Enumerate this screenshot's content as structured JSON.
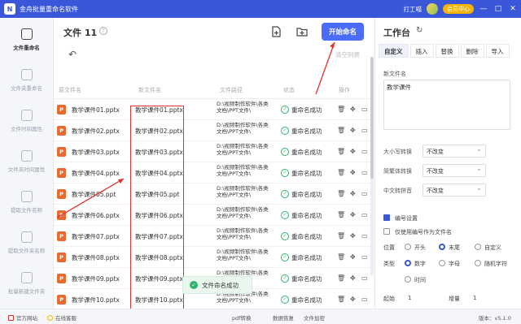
{
  "titlebar": {
    "logo": "N",
    "title": "金舟批量重命名软件",
    "user": "打工喵",
    "vip": "会员中心",
    "min": "—",
    "max": "□",
    "close": "✕"
  },
  "sidebar": {
    "items": [
      {
        "label": "文件重命名"
      },
      {
        "label": "文件夹重命名"
      },
      {
        "label": "文件时间属性"
      },
      {
        "label": "文件夹时间属性"
      },
      {
        "label": "提取文件名称"
      },
      {
        "label": "提取文件夹名称"
      },
      {
        "label": "批量新建文件夹"
      }
    ]
  },
  "main": {
    "title": "文件 11",
    "help": "?",
    "start_label": "开始命名",
    "clear_label": "清空列表",
    "back": "↶",
    "headers": {
      "orig": "原文件名",
      "new": "新文件名",
      "path": "文件路径",
      "status": "状态",
      "ops": "操作"
    },
    "rows": [
      {
        "orig": "教学课件01.pptx",
        "new": "教学课件01.pptx",
        "path": "D:\\视频制作软件\\各类文档\\PPT文件\\",
        "status": "重命名成功",
        "icon": "P"
      },
      {
        "orig": "教学课件02.pptx",
        "new": "教学课件02.pptx",
        "path": "D:\\视频制作软件\\各类文档\\PPT文件\\",
        "status": "重命名成功",
        "icon": "P"
      },
      {
        "orig": "教学课件03.pptx",
        "new": "教学课件03.pptx",
        "path": "D:\\视频制作软件\\各类文档\\PPT文件\\",
        "status": "重命名成功",
        "icon": "P"
      },
      {
        "orig": "教学课件04.pptx",
        "new": "教学课件04.pptx",
        "path": "D:\\视频制作软件\\各类文档\\PPT文件\\",
        "status": "重命名成功",
        "icon": "P"
      },
      {
        "orig": "教学课件05.ppt",
        "new": "教学课件05.ppt",
        "path": "D:\\视频制作软件\\各类文档\\PPT文件\\",
        "status": "重命名成功",
        "icon": "P"
      },
      {
        "orig": "教学课件06.pptx",
        "new": "教学课件06.pptx",
        "path": "D:\\视频制作软件\\各类文档\\PPT文件\\",
        "status": "重命名成功",
        "icon": "P"
      },
      {
        "orig": "教学课件07.pptx",
        "new": "教学课件07.pptx",
        "path": "D:\\视频制作软件\\各类文档\\PPT文件\\",
        "status": "重命名成功",
        "icon": "P"
      },
      {
        "orig": "教学课件08.pptx",
        "new": "教学课件08.pptx",
        "path": "D:\\视频制作软件\\各类文档\\PPT文件\\",
        "status": "重命名成功",
        "icon": "P"
      },
      {
        "orig": "教学课件09.pptx",
        "new": "教学课件09.pptx",
        "path": "D:\\视频制作软件\\各类文档\\PPT文件\\",
        "status": "重命名成功",
        "icon": "P"
      },
      {
        "orig": "教学课件10.pptx",
        "new": "教学课件10.pptx",
        "path": "D:\\视频制作软件\\各类文档\\PPT文件\\",
        "status": "重命名成功",
        "icon": "P"
      }
    ],
    "toast": "文件命名成功"
  },
  "panel": {
    "title": "工作台",
    "tabs": [
      "自定义",
      "插入",
      "替换",
      "删除",
      "导入"
    ],
    "new_name_label": "新文件名",
    "new_name_value": "教学课件",
    "case_label": "大小写转换",
    "case_value": "不改变",
    "trad_label": "简繁体转换",
    "trad_value": "不改变",
    "pinyin_label": "中文转拼音",
    "pinyin_value": "不改变",
    "numbering_label": "编号设置",
    "only_number_label": "仅使用编号作为文件名",
    "position_label": "位置",
    "pos_options": [
      "开头",
      "末尾",
      "自定义"
    ],
    "type_label": "类型",
    "type_options": [
      "数字",
      "字母",
      "随机字符"
    ],
    "time_option": "时间",
    "start_label": "起始",
    "start_value": "1",
    "step_label": "增量",
    "step_value": "1"
  },
  "footer": {
    "site": "官方网站",
    "service": "在线客服",
    "links": [
      "pdf转换",
      "数据恢复",
      "文件加密"
    ],
    "version": "版本：v5.1.0"
  },
  "colors": {
    "brand": "#3b57d9",
    "accent": "#4a6cf7",
    "success": "#2fb36c",
    "highlight": "#e0302b"
  }
}
